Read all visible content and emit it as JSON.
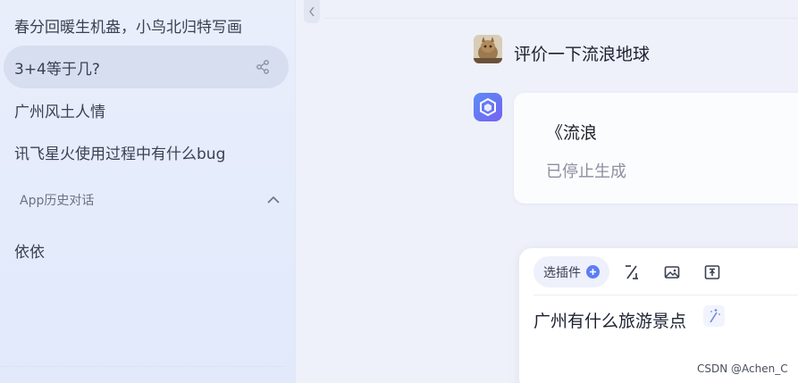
{
  "sidebar": {
    "history": [
      {
        "label": "春分回暖生机盎，小鸟北归特写画"
      },
      {
        "label": "3+4等于几?"
      },
      {
        "label": "广州风土人情"
      },
      {
        "label": "讯飞星火使用过程中有什么bug"
      }
    ],
    "app_group": {
      "title": "App历史对话",
      "items": [
        {
          "label": "依依"
        }
      ]
    }
  },
  "conversation": {
    "user_message": "评价一下流浪地球",
    "bot_reply": "《流浪",
    "bot_status": "已停止生成"
  },
  "composer": {
    "plugin_label": "选插件",
    "input_value": "广州有什么旅游景点"
  },
  "watermark": "CSDN @Achen_C",
  "colors": {
    "accent": "#5b7df6",
    "active_item_bg": "#d7def0",
    "bot_avatar_gradient": [
      "#5a8df8",
      "#7561f2"
    ]
  },
  "icons": {
    "share": "share-icon",
    "chevron_up": "chevron-up-icon",
    "collapse": "chevron-left-icon",
    "plus": "plus-icon",
    "format": "slash-format-icon",
    "image": "image-icon",
    "upload": "upload-icon",
    "magic": "magic-wand-icon"
  }
}
